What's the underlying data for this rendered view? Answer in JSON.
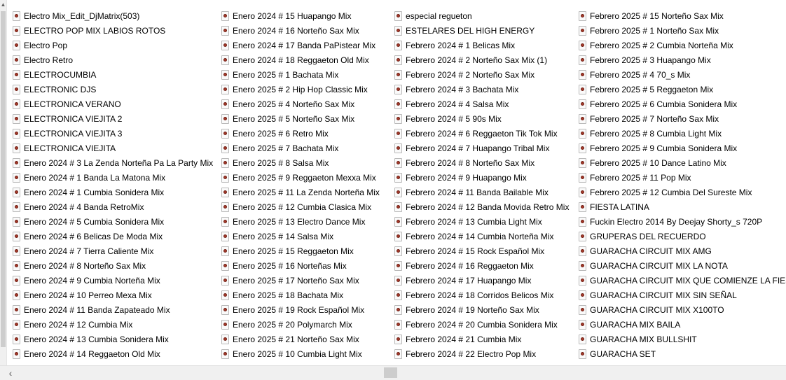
{
  "icons": {
    "file": "media-file-icon",
    "scroll_up": "chevron-up-icon",
    "scroll_left": "chevron-left-icon"
  },
  "columns": [
    [
      "Electro Mix_Edit_DjMatrix(503)",
      "ELECTRO POP MIX LABIOS ROTOS",
      "Electro Pop",
      "Electro Retro",
      "ELECTROCUMBIA",
      "ELECTRONIC DJS",
      "ELECTRONICA VERANO",
      "ELECTRONICA VIEJITA 2",
      "ELECTRONICA VIEJITA 3",
      "ELECTRONICA VIEJITA",
      "Enero 2024 #  3 La Zenda Norteña Pa La Party Mix",
      "Enero 2024 # 1 Banda La Matona Mix",
      "Enero 2024 # 1 Cumbia Sonidera Mix",
      "Enero 2024 # 4 Banda RetroMix",
      "Enero 2024 # 5 Cumbia Sonidera Mix",
      "Enero 2024 # 6 Belicas De Moda Mix",
      "Enero 2024 # 7 Tierra Caliente Mix",
      "Enero 2024 # 8 Norteño Sax Mix",
      "Enero 2024 # 9 Cumbia Norteña Mix",
      "Enero 2024 # 10 Perreo Mexa Mix",
      "Enero 2024 # 11 Banda Zapateado Mix",
      "Enero 2024 # 12 Cumbia Mix",
      "Enero 2024 # 13 Cumbia Sonidera Mix",
      "Enero 2024 # 14 Reggaeton Old Mix"
    ],
    [
      "Enero 2024 # 15 Huapango Mix",
      "Enero 2024 # 16 Norteño Sax Mix",
      "Enero 2024 # 17 Banda PaPistear Mix",
      "Enero 2024 # 18 Reggaeton Old Mix",
      "Enero 2025  # 1   Bachata Mix",
      "Enero 2025  # 2  Hip Hop Classic Mix",
      "Enero 2025  # 4   Norteño Sax Mix",
      "Enero 2025  # 5   Norteño Sax Mix",
      "Enero 2025  # 6   Retro Mix",
      "Enero 2025  # 7   Bachata Mix",
      "Enero 2025  # 8   Salsa Mix",
      "Enero 2025  # 9    Reggaeton Mexxa Mix",
      "Enero 2025  # 11  La Zenda Norteña Mix",
      "Enero 2025  # 12   Cumbia Clasica Mix",
      "Enero 2025  # 13   Electro Dance Mix",
      "Enero 2025  # 14   Salsa Mix",
      "Enero 2025  # 15   Reggaeton Mix",
      "Enero 2025  # 16   Norteñas Mix",
      "Enero 2025  # 17   Norteño Sax Mix",
      "Enero 2025  # 18 Bachata Mix",
      "Enero 2025  # 19 Rock Español Mix",
      "Enero 2025  # 20 Polymarch Mix",
      "Enero 2025  # 21   Norteño Sax Mix",
      "Enero 2025 # 10 Cumbia Light Mix"
    ],
    [
      "especial regueton",
      "ESTELARES DEL HIGH ENERGY",
      "Febrero 2024 # 1 Belicas Mix",
      "Febrero 2024 # 2 Norteño Sax Mix (1)",
      "Febrero 2024 # 2 Norteño Sax Mix",
      "Febrero 2024 # 3 Bachata Mix",
      "Febrero 2024 # 4 Salsa Mix",
      "Febrero 2024 # 5 90s Mix",
      "Febrero 2024 # 6 Reggaeton Tik Tok Mix",
      "Febrero 2024 # 7 Huapango Tribal  Mix",
      "Febrero 2024 # 8 Norteño Sax Mix",
      "Febrero 2024 # 9 Huapango Mix",
      "Febrero 2024 # 11 Banda Bailable Mix",
      "Febrero 2024 # 12 Banda Movida Retro Mix",
      "Febrero 2024 # 13 Cumbia Light Mix",
      "Febrero 2024 # 14 Cumbia Norteña Mix",
      "Febrero 2024 # 15 Rock Español Mix",
      "Febrero 2024 # 16 Reggaeton Mix",
      "Febrero 2024 # 17 Huapango Mix",
      "Febrero 2024 # 18 Corridos Belicos Mix",
      "Febrero 2024 # 19 Norteño Sax Mix",
      "Febrero 2024 # 20 Cumbia Sonidera Mix",
      "Febrero 2024 # 21 Cumbia Mix",
      "Febrero 2024 # 22 Electro Pop Mix"
    ],
    [
      "Febrero 2025   # 15 Norteño Sax Mix",
      "Febrero 2025  # 1  Norteño Sax Mix",
      "Febrero 2025  # 2 Cumbia Norteña Mix",
      "Febrero 2025  # 3  Huapango Mix",
      "Febrero 2025  # 4  70_s Mix",
      "Febrero 2025  # 5 Reggaeton Mix",
      "Febrero 2025  # 6  Cumbia Sonidera Mix",
      "Febrero 2025  # 7 Norteño Sax Mix",
      "Febrero 2025  # 8 Cumbia Light Mix",
      "Febrero 2025  # 9 Cumbia Sonidera Mix",
      "Febrero 2025  # 10  Dance Latino Mix",
      "Febrero 2025  # 11  Pop Mix",
      "Febrero 2025  # 12  Cumbia Del Sureste Mix",
      "FIESTA LATINA",
      "Fuckin Electro 2014 By Deejay Shorty_s 720P",
      "GRUPERAS DEL RECUERDO",
      "GUARACHA CIRCUIT MIX AMG",
      "GUARACHA CIRCUIT MIX LA NOTA",
      "GUARACHA CIRCUIT MIX QUE COMIENZE LA FIESTA",
      "GUARACHA CIRCUIT MIX SIN SEÑAL",
      "GUARACHA CIRCUIT MIX X100TO",
      "GUARACHA MIX BAILA",
      "GUARACHA MIX BULLSHIT",
      "GUARACHA SET"
    ]
  ]
}
